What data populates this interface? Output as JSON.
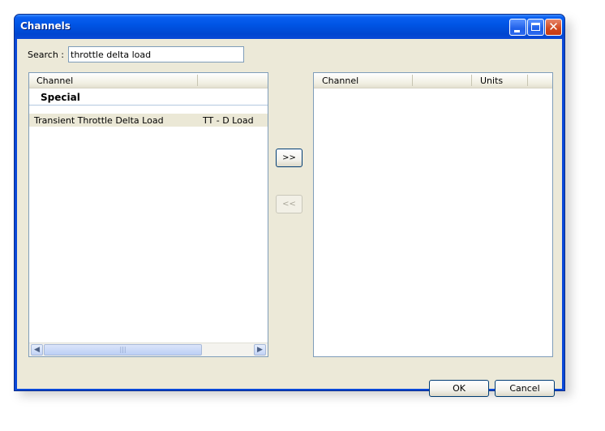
{
  "window": {
    "title": "Channels",
    "controls": [
      "minimize-icon",
      "maximize-icon",
      "close-icon"
    ],
    "close_glyph": "✕"
  },
  "search": {
    "label": "Search :",
    "value": "throttle delta load"
  },
  "available_list": {
    "columns": [
      "Channel",
      ""
    ],
    "group": "Special",
    "items": [
      {
        "name": "Transient Throttle Delta Load",
        "abbreviation": "TT - D Load"
      }
    ],
    "scroll_left": "◀",
    "scroll_right": "▶",
    "scroll_grip": "|||"
  },
  "selected_list": {
    "columns": [
      "Channel",
      "",
      "Units"
    ]
  },
  "buttons": {
    "add": ">>",
    "remove": "<<",
    "ok": "OK",
    "cancel": "Cancel"
  },
  "colors": {
    "titlebar": "#0055e5",
    "dialog_bg": "#ece9d8",
    "list_border": "#7f9db9",
    "selected_row": "#ebe8d6"
  }
}
